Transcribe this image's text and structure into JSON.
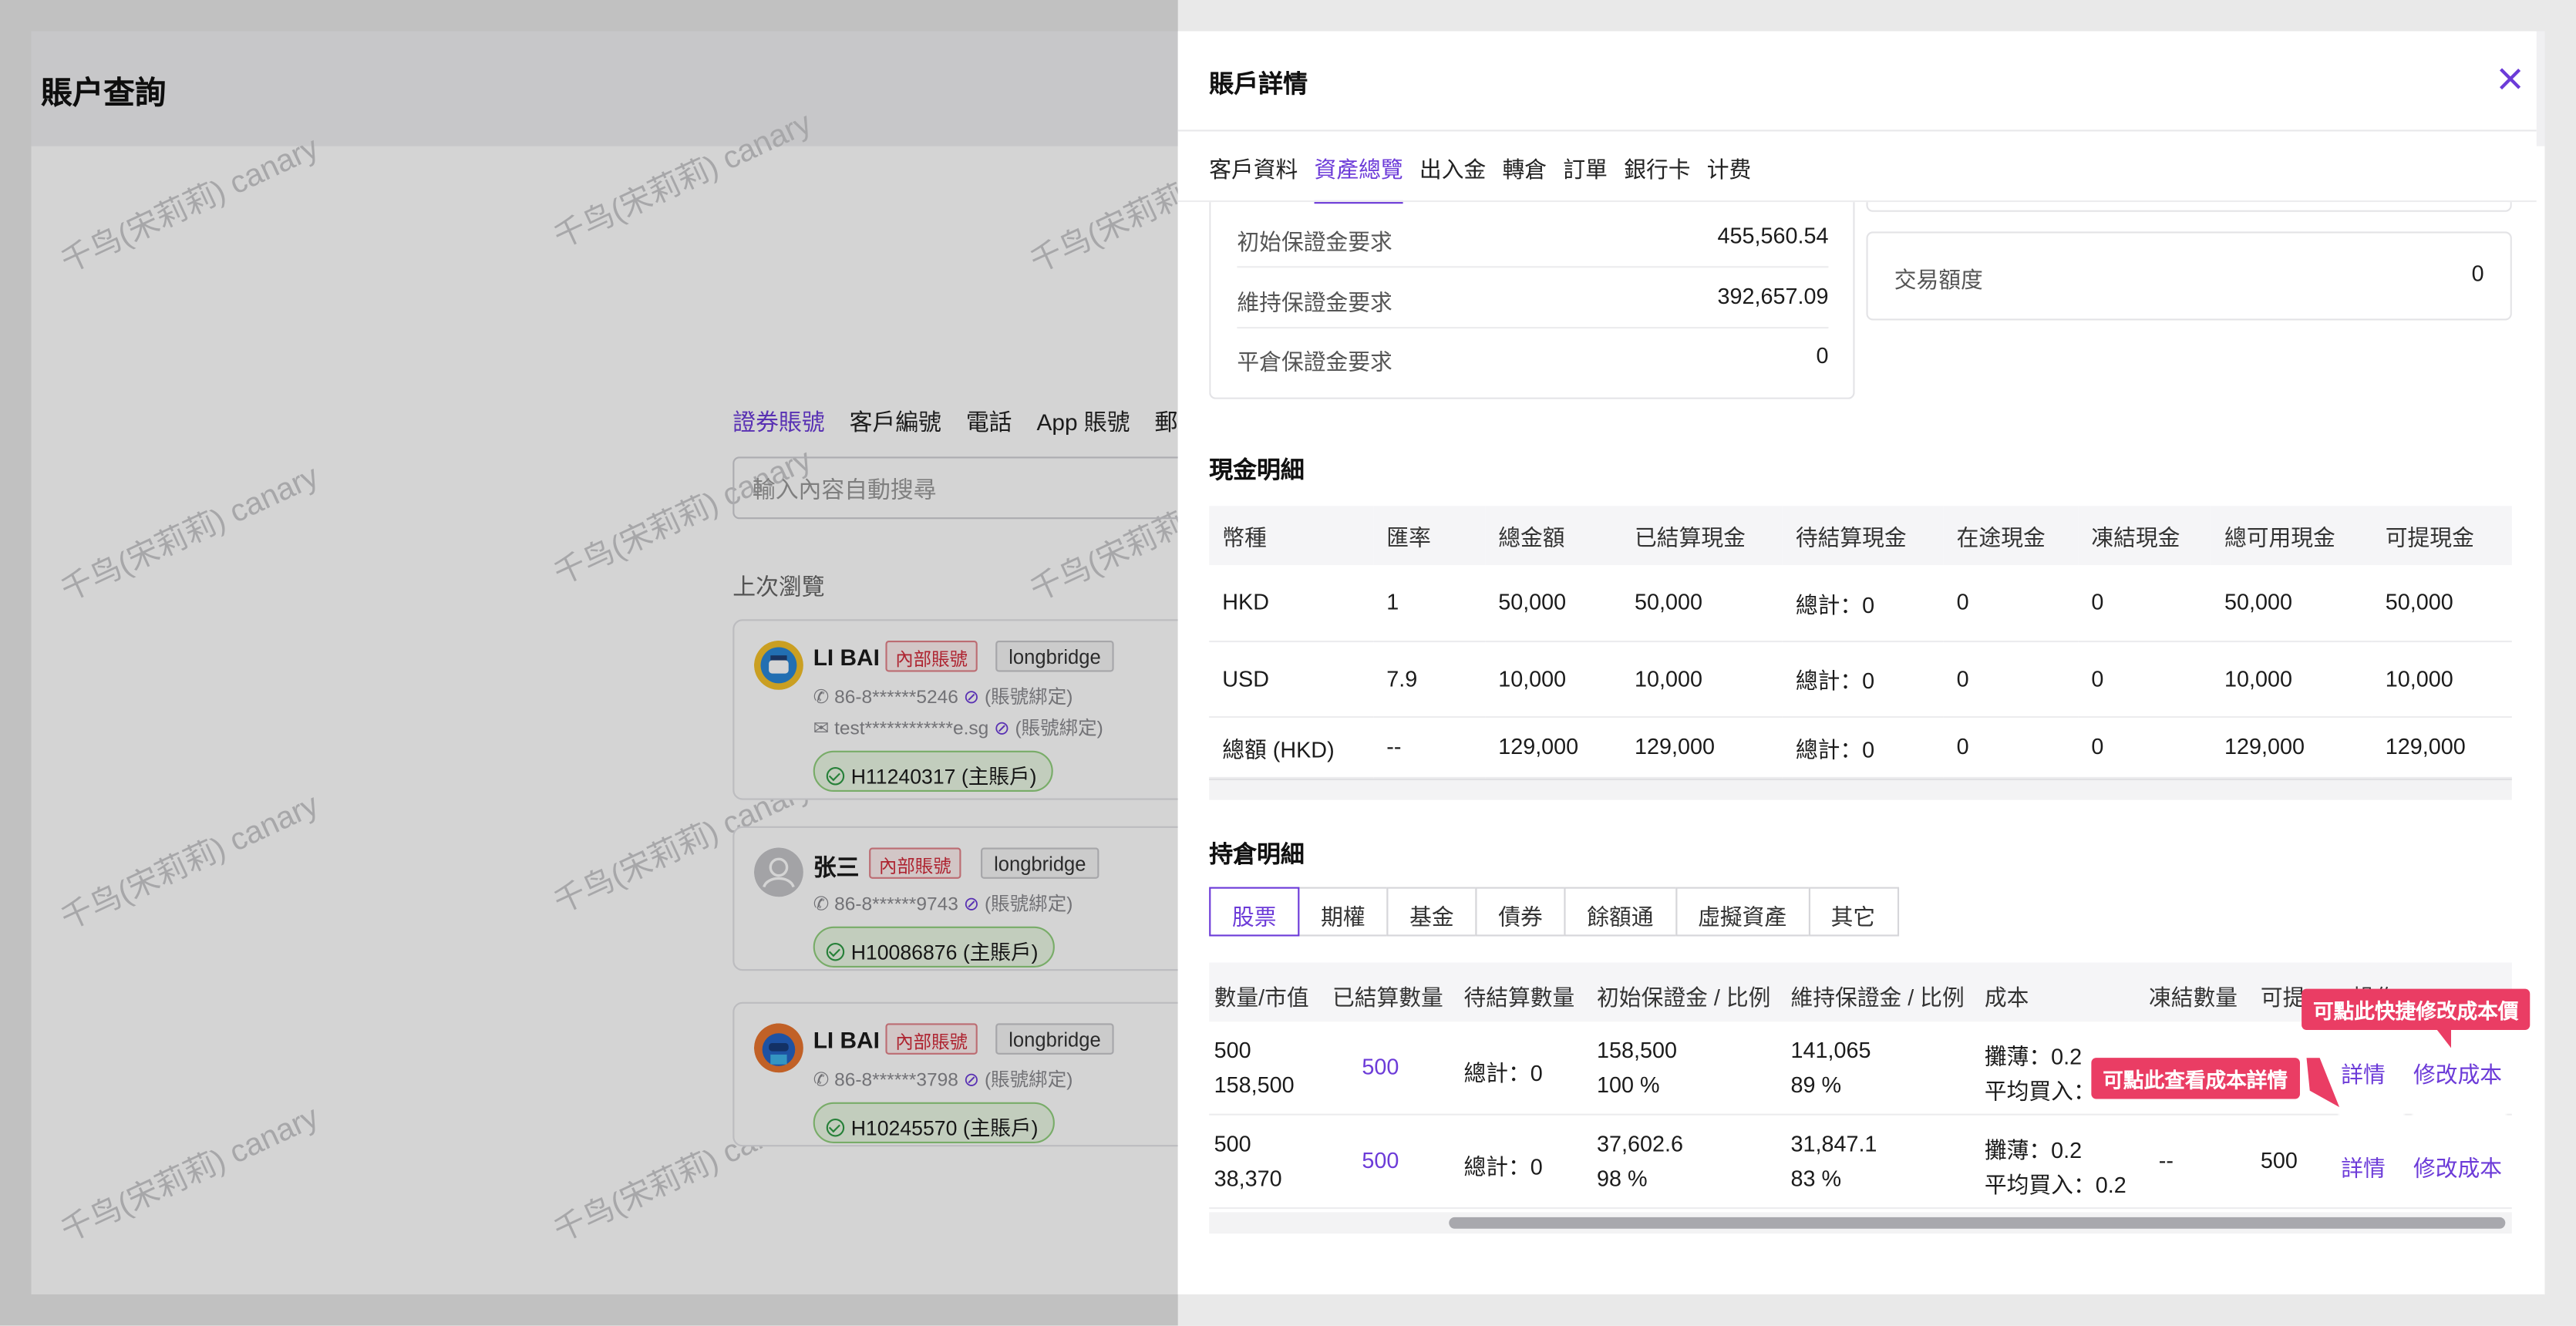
{
  "page": {
    "title": "賬户查詢"
  },
  "search": {
    "tabs": [
      "證券賬號",
      "客戶編號",
      "電話",
      "App 賬號",
      "郵"
    ],
    "placeholder": "輸入內容自動搜尋",
    "recent_label": "上次瀏覽"
  },
  "recent": [
    {
      "name": "LI BAI",
      "badge_internal": "內部賬號",
      "badge_org": "longbridge",
      "phone": "86-8******5246",
      "phone_bind": "(賬號綁定)",
      "email": "test************e.sg",
      "email_bind": "(賬號綁定)",
      "account": "H11240317 (主賬戶)"
    },
    {
      "name": "张三",
      "badge_internal": "內部賬號",
      "badge_org": "longbridge",
      "phone": "86-8******9743",
      "phone_bind": "(賬號綁定)",
      "account": "H10086876 (主賬戶)"
    },
    {
      "name": "LI BAI",
      "badge_internal": "內部賬號",
      "badge_org": "longbridge",
      "phone": "86-8******3798",
      "phone_bind": "(賬號綁定)",
      "account": "H10245570 (主賬戶)"
    }
  ],
  "watermark": "千鸟(宋莉莉) canary",
  "drawer": {
    "title": "賬戶詳情",
    "tabs": [
      "客戶資料",
      "資產總覽",
      "出入金",
      "轉倉",
      "訂單",
      "銀行卡",
      "计费"
    ],
    "active_tab": "資產總覽",
    "margin": [
      {
        "label": "初始保證金要求",
        "value": "455,560.54"
      },
      {
        "label": "維持保證金要求",
        "value": "392,657.09"
      },
      {
        "label": "平倉保證金要求",
        "value": "0"
      }
    ],
    "trade_limit": {
      "label": "交易額度",
      "value": "0"
    },
    "cash": {
      "title": "現金明細",
      "columns": [
        "幣種",
        "匯率",
        "總金額",
        "已結算現金",
        "待結算現金",
        "在途現金",
        "凍結現金",
        "總可用現金",
        "可提現金"
      ],
      "rows": [
        [
          "HKD",
          "1",
          "50,000",
          "50,000",
          "總計：0",
          "0",
          "0",
          "50,000",
          "50,000"
        ],
        [
          "USD",
          "7.9",
          "10,000",
          "10,000",
          "總計：0",
          "0",
          "0",
          "10,000",
          "10,000"
        ],
        [
          "總額 (HKD)",
          "--",
          "129,000",
          "129,000",
          "總計：0",
          "0",
          "0",
          "129,000",
          "129,000"
        ]
      ]
    },
    "holdings": {
      "title": "持倉明細",
      "tabs": [
        "股票",
        "期權",
        "基金",
        "債券",
        "餘額通",
        "虛擬資產",
        "其它"
      ],
      "active_tab": "股票",
      "columns": [
        "數量/市值",
        "已結算數量",
        "待結算數量",
        "初始保證金 / 比例",
        "維持保證金 / 比例",
        "成本",
        "凍結數量",
        "可提",
        "操作"
      ],
      "rows": [
        {
          "qty": "500",
          "mv": "158,500",
          "settled": "500",
          "pending": "總計：0",
          "im": "158,500",
          "im_pct": "100 %",
          "mm": "141,065",
          "mm_pct": "89 %",
          "cost1": "攤薄：0.2",
          "cost2": "平均買入：",
          "frozen": "",
          "withdrawable": "",
          "detail": "詳情",
          "edit": "修改成本"
        },
        {
          "qty": "500",
          "mv": "38,370",
          "settled": "500",
          "pending": "總計：0",
          "im": "37,602.6",
          "im_pct": "98 %",
          "mm": "31,847.1",
          "mm_pct": "83 %",
          "cost1": "攤薄：0.2",
          "cost2": "平均買入：0.2",
          "frozen": "--",
          "withdrawable": "500",
          "detail": "詳情",
          "edit": "修改成本"
        }
      ]
    },
    "callouts": {
      "edit_cost": "可點此快捷修改成本價",
      "view_detail": "可點此查看成本詳情"
    }
  },
  "colors": {
    "accent": "#6c3bd8",
    "callout": "#ea3d64",
    "internal_badge": "#d22b3a",
    "account_pill": "#91cf7d"
  }
}
